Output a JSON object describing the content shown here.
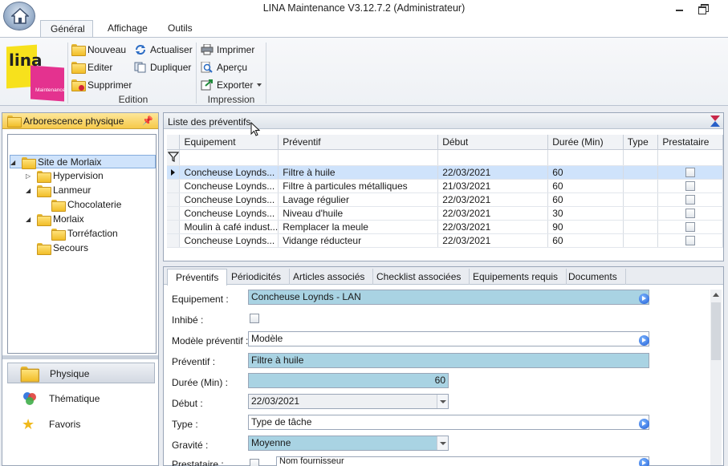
{
  "window": {
    "title": "LINA Maintenance  V3.12.7.2  (Administrateur)"
  },
  "ribbon": {
    "tabs": [
      "Général",
      "Affichage",
      "Outils"
    ],
    "logo": {
      "text": "lina",
      "subtitle": "Maintenance"
    },
    "edition": {
      "label": "Edition",
      "nouveau": "Nouveau",
      "editer": "Editer",
      "supprimer": "Supprimer",
      "actualiser": "Actualiser",
      "dupliquer": "Dupliquer"
    },
    "impression": {
      "label": "Impression",
      "imprimer": "Imprimer",
      "apercu": "Aperçu",
      "exporter": "Exporter"
    }
  },
  "left": {
    "title": "Arborescence physique",
    "tree": [
      "Site de Morlaix",
      "Hypervision",
      "Lanmeur",
      "Chocolaterie",
      "Morlaix",
      "Torréfaction",
      "Secours"
    ],
    "nav": [
      "Physique",
      "Thématique",
      "Favoris"
    ]
  },
  "grid": {
    "title": "Liste des préventifs",
    "columns": [
      "Equipement",
      "Préventif",
      "Début",
      "Durée (Min)",
      "Type",
      "Prestataire"
    ],
    "rows": [
      [
        "Concheuse  Loynds...",
        "Filtre à huile",
        "22/03/2021",
        "60",
        "",
        ""
      ],
      [
        "Concheuse  Loynds...",
        "Filtre à particules métalliques",
        "21/03/2021",
        "60",
        "",
        ""
      ],
      [
        "Concheuse  Loynds...",
        "Lavage régulier",
        "22/03/2021",
        "60",
        "",
        ""
      ],
      [
        "Concheuse  Loynds...",
        "Niveau d'huile",
        "22/03/2021",
        "30",
        "",
        ""
      ],
      [
        "Moulin à café indust...",
        "Remplacer la meule",
        "22/03/2021",
        "90",
        "",
        ""
      ],
      [
        "Concheuse  Loynds...",
        "Vidange réducteur",
        "22/03/2021",
        "60",
        "",
        ""
      ]
    ]
  },
  "detail": {
    "tabs": [
      "Préventifs",
      "Périodicités",
      "Articles associés",
      "Checklist associées",
      "Equipements requis",
      "Documents"
    ],
    "labels": {
      "equipement": "Equipement :",
      "inhibe": "Inhibé :",
      "modele": "Modèle préventif :",
      "preventif": "Préventif :",
      "duree": "Durée (Min) :",
      "debut": "Début :",
      "type": "Type :",
      "gravite": "Gravité :",
      "prestataire": "Prestataire :"
    },
    "values": {
      "equipement": "Concheuse Loynds - LAN",
      "modele": "Modèle",
      "preventif": "Filtre à huile",
      "duree": "60",
      "debut": "22/03/2021",
      "type": "Type de tâche",
      "gravite": "Moyenne",
      "prestataire": "Nom fournisseur"
    }
  },
  "colors": {
    "selection": "#cfe3fb",
    "field_blue": "#a9d3e3",
    "header_yellow": "#f6c94a"
  }
}
